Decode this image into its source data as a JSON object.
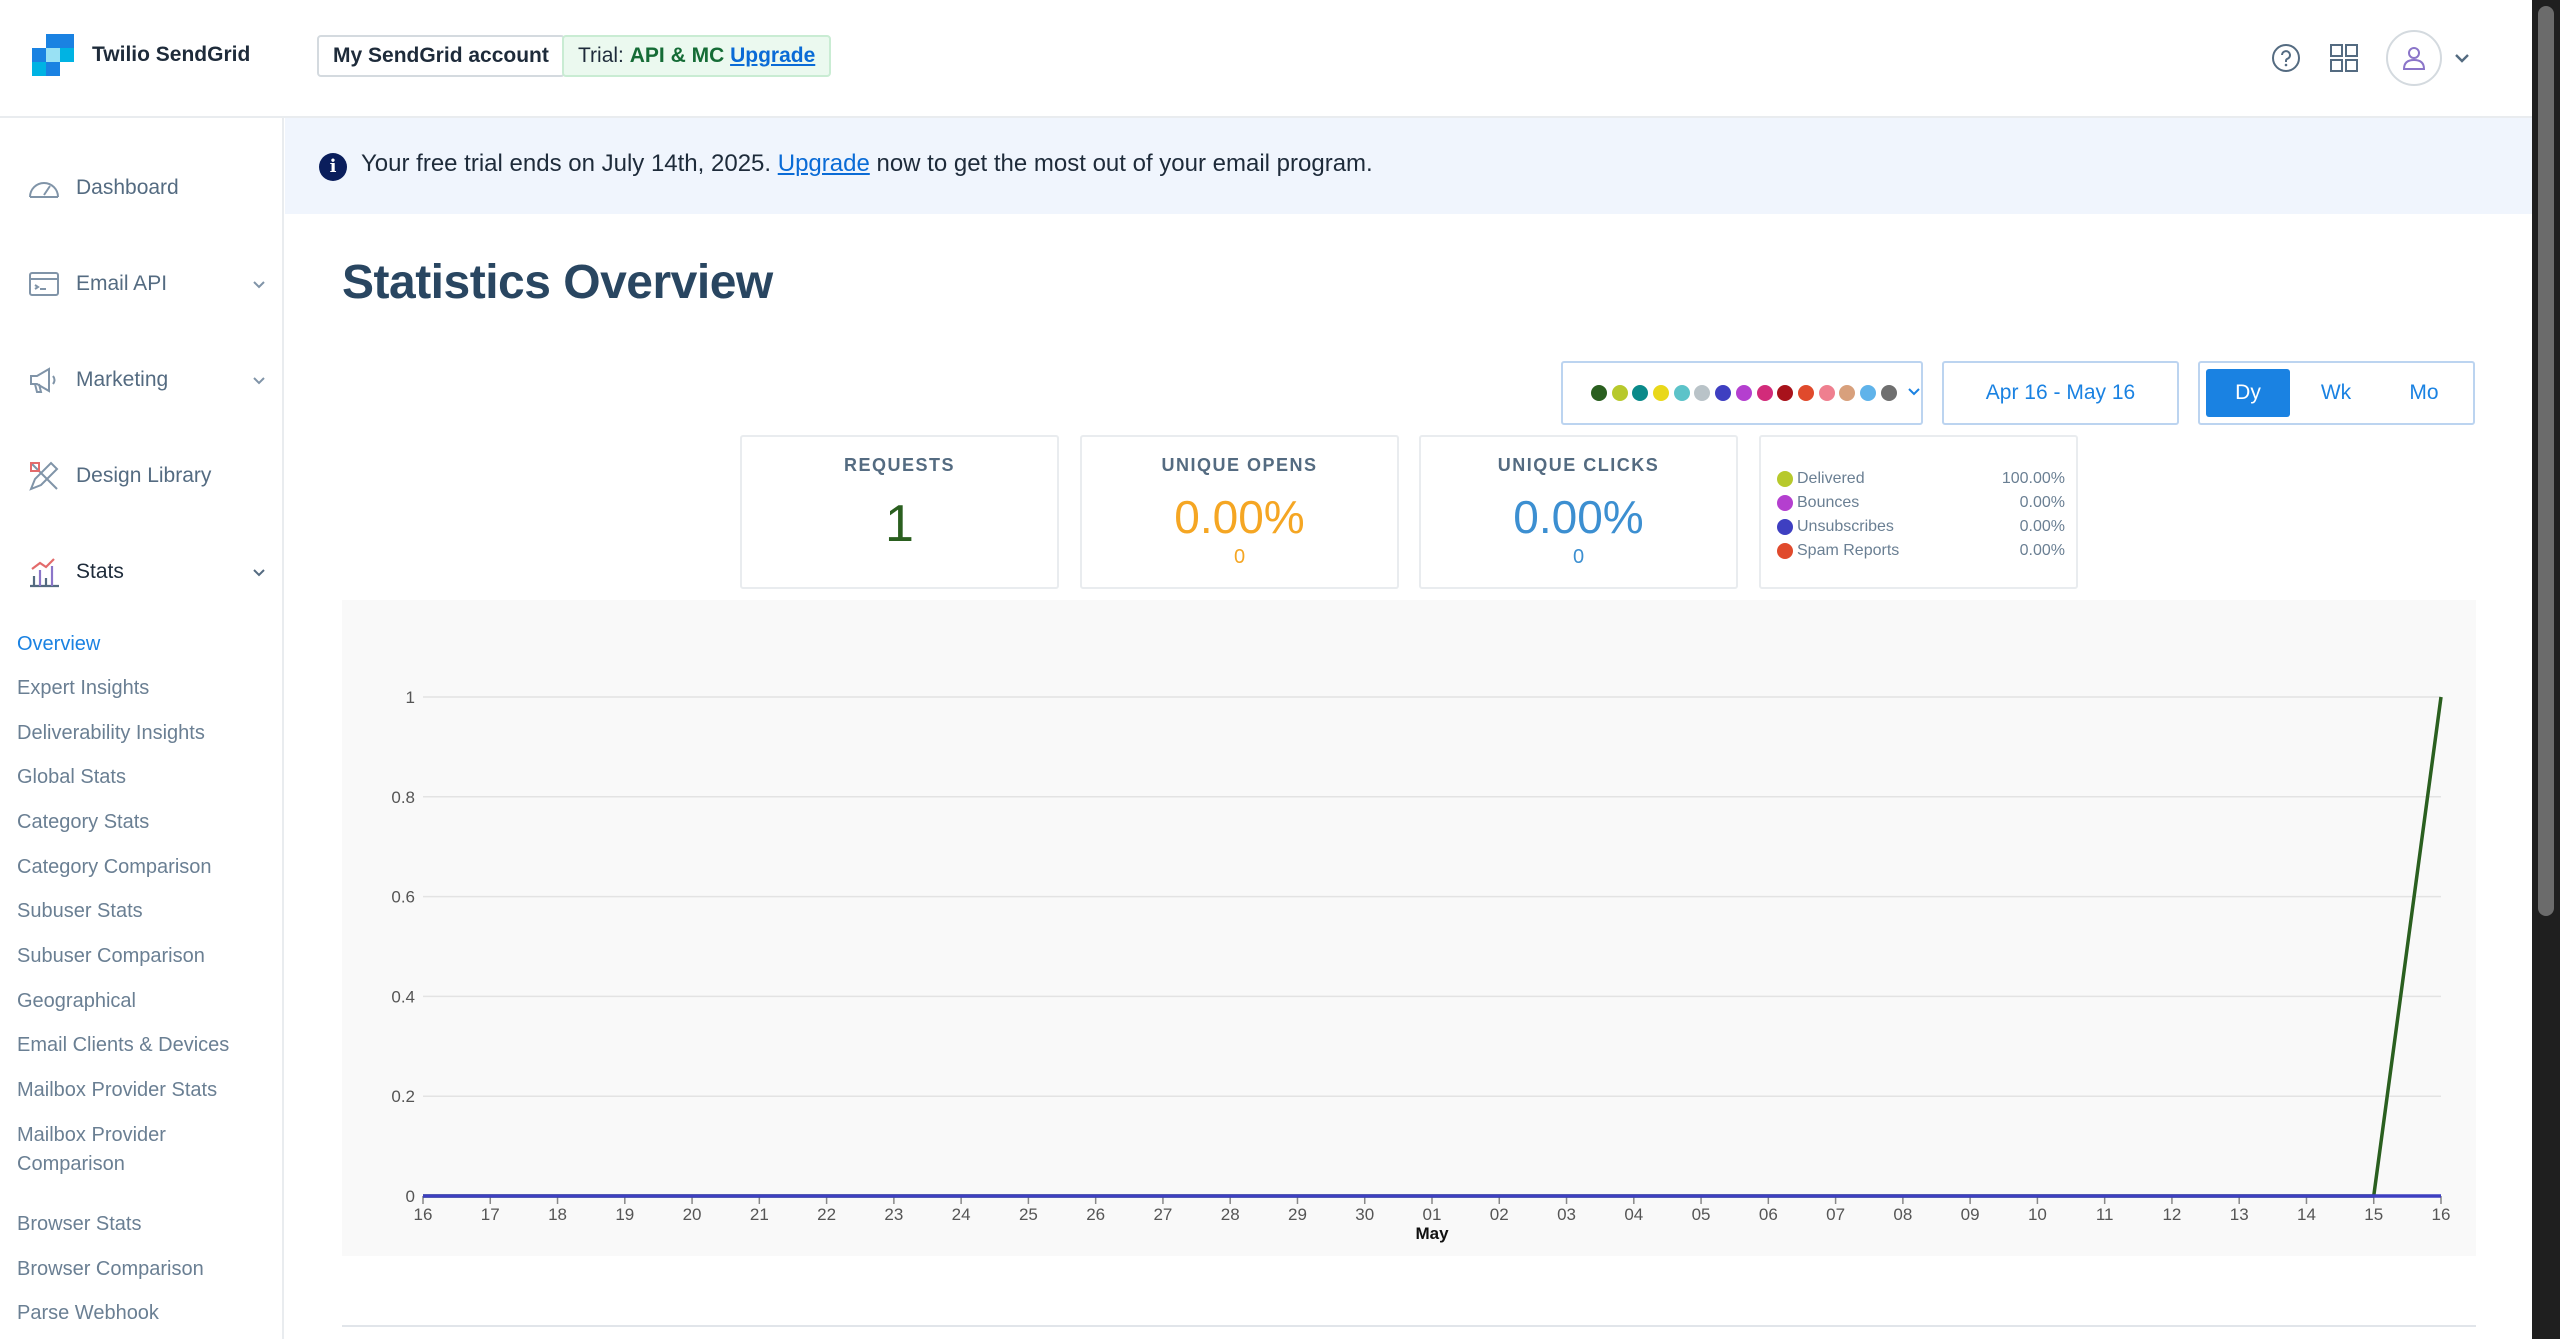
{
  "header": {
    "brand": "Twilio SendGrid",
    "account_button": "My SendGrid account",
    "trial_prefix": "Trial:",
    "trial_plan": "API & MC",
    "trial_upgrade": "Upgrade",
    "icons": [
      "help-icon",
      "apps-grid-icon",
      "user-avatar-icon",
      "chevron-down-icon"
    ]
  },
  "sidebar": {
    "items": [
      {
        "label": "Dashboard",
        "icon": "gauge-icon"
      },
      {
        "label": "Email API",
        "icon": "terminal-window-icon"
      },
      {
        "label": "Marketing",
        "icon": "megaphone-icon"
      },
      {
        "label": "Design Library",
        "icon": "design-tools-icon"
      },
      {
        "label": "Stats",
        "icon": "bar-chart-icon"
      }
    ],
    "stats_submenu": [
      "Overview",
      "Expert Insights",
      "Deliverability Insights",
      "Global Stats",
      "Category Stats",
      "Category Comparison",
      "Subuser Stats",
      "Subuser Comparison",
      "Geographical",
      "Email Clients & Devices",
      "Mailbox Provider Stats",
      "Mailbox Provider",
      "Comparison",
      "Browser Stats",
      "Browser Comparison",
      "Parse Webhook"
    ]
  },
  "banner": {
    "text_before": "Your free trial ends on July 14th, 2025.",
    "link": "Upgrade",
    "text_after": "now to get the most out of your email program."
  },
  "page": {
    "title": "Statistics Overview"
  },
  "controls": {
    "metric_colors": [
      "#2a5f1f",
      "#b7c92c",
      "#0a8a8a",
      "#e9d81a",
      "#5cc3c9",
      "#b9c3c8",
      "#3e3fc1",
      "#b43fcf",
      "#d22b7a",
      "#a8121b",
      "#e04a2c",
      "#ef7f8f",
      "#d8a07c",
      "#5fb3ea",
      "#6f6f6f"
    ],
    "date_range": "Apr 16 - May 16",
    "periods": [
      "Dy",
      "Wk",
      "Mo"
    ],
    "selected_period": "Dy"
  },
  "stats": {
    "requests": {
      "label": "REQUESTS",
      "value": "1",
      "color": "#2a5f1f"
    },
    "unique_opens": {
      "label": "UNIQUE OPENS",
      "value": "0.00%",
      "sub": "0",
      "color": "#f5a623"
    },
    "unique_clicks": {
      "label": "UNIQUE CLICKS",
      "value": "0.00%",
      "sub": "0",
      "color": "#3c8fd1"
    }
  },
  "legend": [
    {
      "name": "Delivered",
      "value": "100.00%",
      "color": "#b7c92c"
    },
    {
      "name": "Bounces",
      "value": "0.00%",
      "color": "#b43fcf"
    },
    {
      "name": "Unsubscribes",
      "value": "0.00%",
      "color": "#3e3fc1"
    },
    {
      "name": "Spam Reports",
      "value": "0.00%",
      "color": "#e04a2c"
    }
  ],
  "chart_data": {
    "type": "line",
    "x": [
      "16",
      "17",
      "18",
      "19",
      "20",
      "21",
      "22",
      "23",
      "24",
      "25",
      "26",
      "27",
      "28",
      "29",
      "30",
      "01",
      "02",
      "03",
      "04",
      "05",
      "06",
      "07",
      "08",
      "09",
      "10",
      "11",
      "12",
      "13",
      "14",
      "15",
      "16"
    ],
    "x_month_label": "May",
    "ylim": [
      0,
      1
    ],
    "yticks": [
      "0",
      "0.2",
      "0.4",
      "0.6",
      "0.8",
      "1"
    ],
    "grid": true,
    "series": [
      {
        "color": "#2a5f1f",
        "values": [
          0,
          0,
          0,
          0,
          0,
          0,
          0,
          0,
          0,
          0,
          0,
          0,
          0,
          0,
          0,
          0,
          0,
          0,
          0,
          0,
          0,
          0,
          0,
          0,
          0,
          0,
          0,
          0,
          0,
          0,
          1
        ]
      },
      {
        "color": "#3e3fc1",
        "values": [
          0,
          0,
          0,
          0,
          0,
          0,
          0,
          0,
          0,
          0,
          0,
          0,
          0,
          0,
          0,
          0,
          0,
          0,
          0,
          0,
          0,
          0,
          0,
          0,
          0,
          0,
          0,
          0,
          0,
          0,
          0
        ]
      }
    ]
  }
}
